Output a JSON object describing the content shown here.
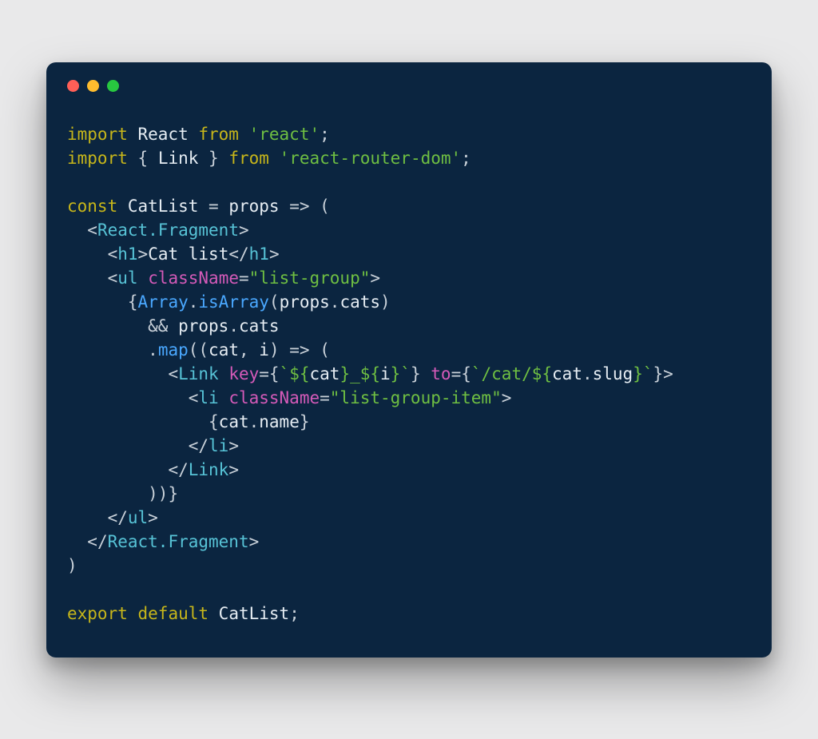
{
  "colors": {
    "bg_page": "#e9e9ea",
    "bg_window": "#0b2540",
    "traffic_red": "#ff5f57",
    "traffic_yellow": "#febc2e",
    "traffic_green": "#28c840",
    "kw": "#c7b61a",
    "fn": "#4aa8ff",
    "str": "#6fbf42",
    "tag": "#57c3d6",
    "attr": "#d45ab8",
    "text": "#e6edf3"
  },
  "code": {
    "lines": [
      [
        [
          "kw",
          "import"
        ],
        [
          "id",
          " React "
        ],
        [
          "kw",
          "from"
        ],
        [
          "id",
          " "
        ],
        [
          "str",
          "'react'"
        ],
        [
          "punc",
          ";"
        ]
      ],
      [
        [
          "kw",
          "import"
        ],
        [
          "id",
          " "
        ],
        [
          "punc",
          "{"
        ],
        [
          "id",
          " Link "
        ],
        [
          "punc",
          "}"
        ],
        [
          "id",
          " "
        ],
        [
          "kw",
          "from"
        ],
        [
          "id",
          " "
        ],
        [
          "str",
          "'react-router-dom'"
        ],
        [
          "punc",
          ";"
        ]
      ],
      [
        [
          "id",
          ""
        ]
      ],
      [
        [
          "kw",
          "const"
        ],
        [
          "id",
          " CatList "
        ],
        [
          "punc",
          "="
        ],
        [
          "id",
          " props "
        ],
        [
          "punc",
          "=>"
        ],
        [
          "id",
          " "
        ],
        [
          "punc",
          "("
        ]
      ],
      [
        [
          "id",
          "  "
        ],
        [
          "punc",
          "<"
        ],
        [
          "tag",
          "React.Fragment"
        ],
        [
          "punc",
          ">"
        ]
      ],
      [
        [
          "id",
          "    "
        ],
        [
          "punc",
          "<"
        ],
        [
          "tag",
          "h1"
        ],
        [
          "punc",
          ">"
        ],
        [
          "id",
          "Cat list"
        ],
        [
          "punc",
          "</"
        ],
        [
          "tag",
          "h1"
        ],
        [
          "punc",
          ">"
        ]
      ],
      [
        [
          "id",
          "    "
        ],
        [
          "punc",
          "<"
        ],
        [
          "tag",
          "ul"
        ],
        [
          "id",
          " "
        ],
        [
          "attr",
          "className"
        ],
        [
          "punc",
          "="
        ],
        [
          "str",
          "\"list-group\""
        ],
        [
          "punc",
          ">"
        ]
      ],
      [
        [
          "id",
          "      "
        ],
        [
          "punc",
          "{"
        ],
        [
          "fn",
          "Array"
        ],
        [
          "punc",
          "."
        ],
        [
          "fn",
          "isArray"
        ],
        [
          "punc",
          "("
        ],
        [
          "id",
          "props"
        ],
        [
          "punc",
          "."
        ],
        [
          "id",
          "cats"
        ],
        [
          "punc",
          ")"
        ]
      ],
      [
        [
          "id",
          "        "
        ],
        [
          "punc",
          "&&"
        ],
        [
          "id",
          " props"
        ],
        [
          "punc",
          "."
        ],
        [
          "id",
          "cats"
        ]
      ],
      [
        [
          "id",
          "        "
        ],
        [
          "punc",
          "."
        ],
        [
          "fn",
          "map"
        ],
        [
          "punc",
          "(("
        ],
        [
          "id",
          "cat"
        ],
        [
          "punc",
          ", "
        ],
        [
          "id",
          "i"
        ],
        [
          "punc",
          ")"
        ],
        [
          "id",
          " "
        ],
        [
          "punc",
          "=>"
        ],
        [
          "id",
          " "
        ],
        [
          "punc",
          "("
        ]
      ],
      [
        [
          "id",
          "          "
        ],
        [
          "punc",
          "<"
        ],
        [
          "tag",
          "Link"
        ],
        [
          "id",
          " "
        ],
        [
          "attr",
          "key"
        ],
        [
          "punc",
          "={"
        ],
        [
          "str",
          "`${"
        ],
        [
          "id",
          "cat"
        ],
        [
          "str",
          "}_${"
        ],
        [
          "id",
          "i"
        ],
        [
          "str",
          "}`"
        ],
        [
          "punc",
          "}"
        ],
        [
          "id",
          " "
        ],
        [
          "attr",
          "to"
        ],
        [
          "punc",
          "={"
        ],
        [
          "str",
          "`/cat/${"
        ],
        [
          "id",
          "cat"
        ],
        [
          "punc",
          "."
        ],
        [
          "id",
          "slug"
        ],
        [
          "str",
          "}`"
        ],
        [
          "punc",
          "}>"
        ]
      ],
      [
        [
          "id",
          "            "
        ],
        [
          "punc",
          "<"
        ],
        [
          "tag",
          "li"
        ],
        [
          "id",
          " "
        ],
        [
          "attr",
          "className"
        ],
        [
          "punc",
          "="
        ],
        [
          "str",
          "\"list-group-item\""
        ],
        [
          "punc",
          ">"
        ]
      ],
      [
        [
          "id",
          "              "
        ],
        [
          "punc",
          "{"
        ],
        [
          "id",
          "cat"
        ],
        [
          "punc",
          "."
        ],
        [
          "id",
          "name"
        ],
        [
          "punc",
          "}"
        ]
      ],
      [
        [
          "id",
          "            "
        ],
        [
          "punc",
          "</"
        ],
        [
          "tag",
          "li"
        ],
        [
          "punc",
          ">"
        ]
      ],
      [
        [
          "id",
          "          "
        ],
        [
          "punc",
          "</"
        ],
        [
          "tag",
          "Link"
        ],
        [
          "punc",
          ">"
        ]
      ],
      [
        [
          "id",
          "        "
        ],
        [
          "punc",
          "))}"
        ]
      ],
      [
        [
          "id",
          "    "
        ],
        [
          "punc",
          "</"
        ],
        [
          "tag",
          "ul"
        ],
        [
          "punc",
          ">"
        ]
      ],
      [
        [
          "id",
          "  "
        ],
        [
          "punc",
          "</"
        ],
        [
          "tag",
          "React.Fragment"
        ],
        [
          "punc",
          ">"
        ]
      ],
      [
        [
          "punc",
          ")"
        ]
      ],
      [
        [
          "id",
          ""
        ]
      ],
      [
        [
          "kw",
          "export"
        ],
        [
          "id",
          " "
        ],
        [
          "kw",
          "default"
        ],
        [
          "id",
          " CatList"
        ],
        [
          "punc",
          ";"
        ]
      ]
    ]
  }
}
